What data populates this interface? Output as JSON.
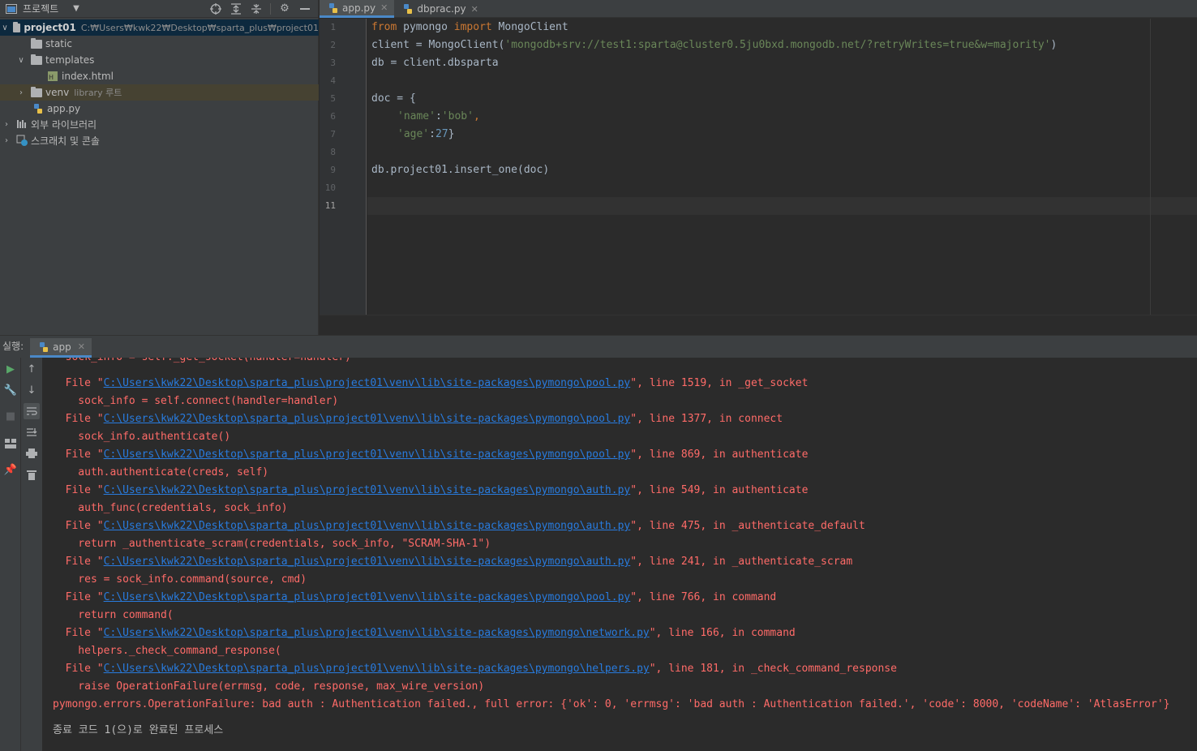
{
  "project": {
    "header_title": "프로젝트",
    "root_name": "project01",
    "root_path": "C:₩Users₩kwk22₩Desktop₩sparta_plus₩project01",
    "items": [
      {
        "label": "static"
      },
      {
        "label": "templates"
      },
      {
        "label": "index.html"
      },
      {
        "label": "venv",
        "sub": "library 루트"
      },
      {
        "label": "app.py"
      },
      {
        "label": "외부 라이브러리"
      },
      {
        "label": "스크래치 및 콘솔"
      }
    ]
  },
  "tabs": [
    {
      "label": "app.py"
    },
    {
      "label": "dbprac.py"
    }
  ],
  "editor": {
    "line_numbers": [
      "1",
      "2",
      "3",
      "4",
      "5",
      "6",
      "7",
      "8",
      "9",
      "10",
      "11"
    ]
  },
  "run": {
    "label": "실행:",
    "tab": "app",
    "lines": [
      {
        "pre": "  sock_info = self._get_socket(handler=handler)"
      },
      {
        "pre": "  File \"",
        "link": "C:\\Users\\kwk22\\Desktop\\sparta_plus\\project01\\venv\\lib\\site-packages\\pymongo\\pool.py",
        "post": "\", line 1519, in _get_socket"
      },
      {
        "pre": "    sock_info = self.connect(handler=handler)"
      },
      {
        "pre": "  File \"",
        "link": "C:\\Users\\kwk22\\Desktop\\sparta_plus\\project01\\venv\\lib\\site-packages\\pymongo\\pool.py",
        "post": "\", line 1377, in connect"
      },
      {
        "pre": "    sock_info.authenticate()"
      },
      {
        "pre": "  File \"",
        "link": "C:\\Users\\kwk22\\Desktop\\sparta_plus\\project01\\venv\\lib\\site-packages\\pymongo\\pool.py",
        "post": "\", line 869, in authenticate"
      },
      {
        "pre": "    auth.authenticate(creds, self)"
      },
      {
        "pre": "  File \"",
        "link": "C:\\Users\\kwk22\\Desktop\\sparta_plus\\project01\\venv\\lib\\site-packages\\pymongo\\auth.py",
        "post": "\", line 549, in authenticate"
      },
      {
        "pre": "    auth_func(credentials, sock_info)"
      },
      {
        "pre": "  File \"",
        "link": "C:\\Users\\kwk22\\Desktop\\sparta_plus\\project01\\venv\\lib\\site-packages\\pymongo\\auth.py",
        "post": "\", line 475, in _authenticate_default"
      },
      {
        "pre": "    return _authenticate_scram(credentials, sock_info, \"SCRAM-SHA-1\")"
      },
      {
        "pre": "  File \"",
        "link": "C:\\Users\\kwk22\\Desktop\\sparta_plus\\project01\\venv\\lib\\site-packages\\pymongo\\auth.py",
        "post": "\", line 241, in _authenticate_scram"
      },
      {
        "pre": "    res = sock_info.command(source, cmd)"
      },
      {
        "pre": "  File \"",
        "link": "C:\\Users\\kwk22\\Desktop\\sparta_plus\\project01\\venv\\lib\\site-packages\\pymongo\\pool.py",
        "post": "\", line 766, in command"
      },
      {
        "pre": "    return command("
      },
      {
        "pre": "  File \"",
        "link": "C:\\Users\\kwk22\\Desktop\\sparta_plus\\project01\\venv\\lib\\site-packages\\pymongo\\network.py",
        "post": "\", line 166, in command"
      },
      {
        "pre": "    helpers._check_command_response("
      },
      {
        "pre": "  File \"",
        "link": "C:\\Users\\kwk22\\Desktop\\sparta_plus\\project01\\venv\\lib\\site-packages\\pymongo\\helpers.py",
        "post": "\", line 181, in _check_command_response"
      },
      {
        "pre": "    raise OperationFailure(errmsg, code, response, max_wire_version)"
      },
      {
        "pre": "pymongo.errors.OperationFailure: bad auth : Authentication failed., full error: {'ok': 0, 'errmsg': 'bad auth : Authentication failed.', 'code': 8000, 'codeName': 'AtlasError'}"
      }
    ],
    "exit_message": "종료 코드 1(으)로 완료된 프로세스"
  },
  "code": {
    "l1_from": "from",
    "l1_mod": " pymongo ",
    "l1_import": "import",
    "l1_cls": " MongoClient",
    "l2_a": "client = MongoClient(",
    "l2_str": "'mongodb+srv://test1:sparta@cluster0.5ju0bxd.mongodb.net/?retryWrites=true&w=majority'",
    "l2_b": ")",
    "l3": "db = client.dbsparta",
    "l5": "doc = {",
    "l6_key": "'name'",
    "l6_sep": ":",
    "l6_val": "'bob'",
    "l6_end": ",",
    "l7_key": "'age'",
    "l7_sep": ":",
    "l7_val": "27",
    "l7_end": "}",
    "l9": "db.project01.insert_one(doc)"
  }
}
